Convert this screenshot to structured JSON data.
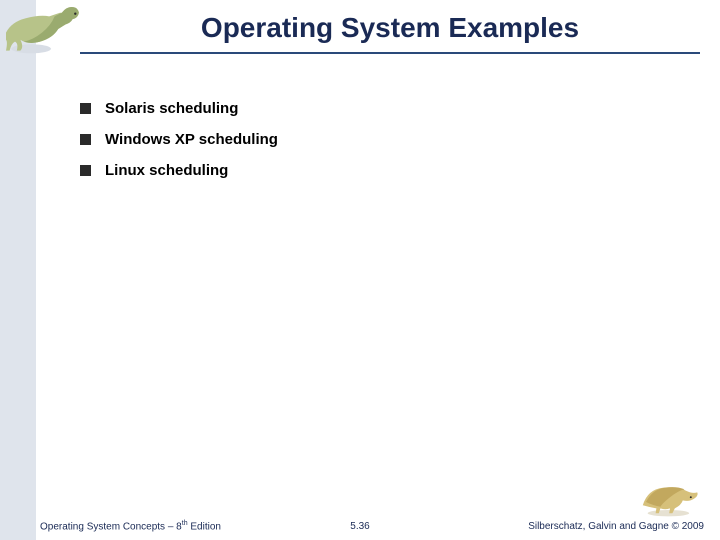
{
  "header": {
    "title": "Operating System Examples"
  },
  "bullets": {
    "0": "Solaris scheduling",
    "1": "Windows XP scheduling",
    "2": "Linux scheduling"
  },
  "footer": {
    "left_prefix": "Operating System Concepts – 8",
    "left_sup": "th",
    "left_suffix": " Edition",
    "center": "5.36",
    "right": "Silberschatz, Galvin and Gagne © 2009"
  },
  "icons": {
    "top_dino": "dinosaur-icon",
    "bottom_dino": "dinosaur-icon"
  },
  "colors": {
    "accent": "#1a2a55",
    "sidebar": "#dfe4ec"
  }
}
